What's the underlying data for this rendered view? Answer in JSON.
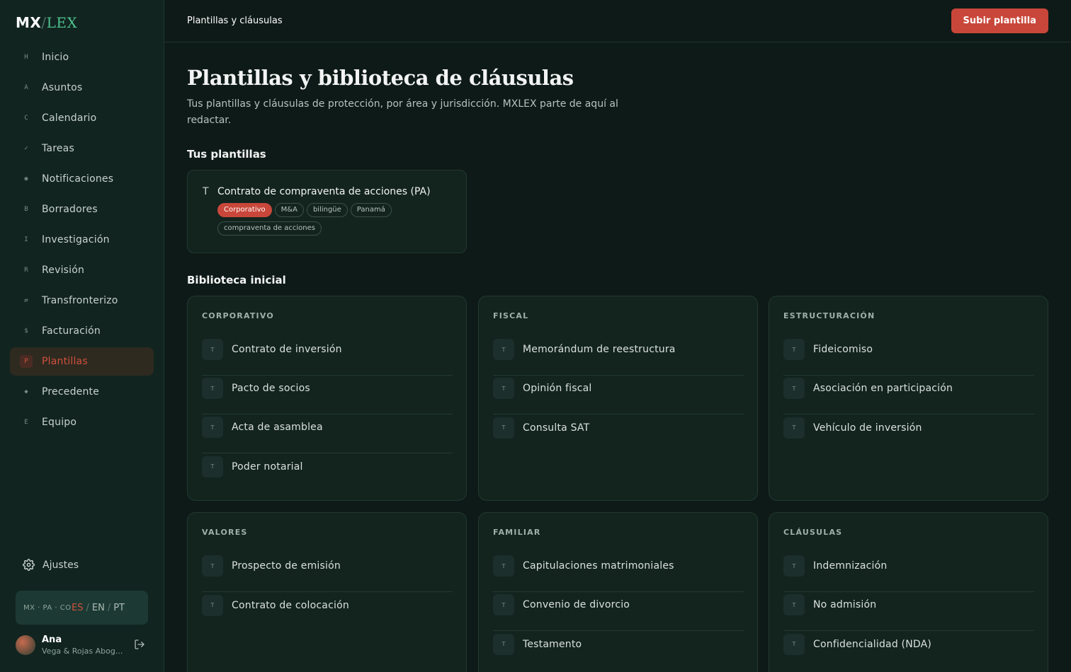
{
  "brand": {
    "mx": "MX",
    "slash": "/",
    "lex": "LEX"
  },
  "sidebar": {
    "items": [
      {
        "icon": "H",
        "label": "Inicio"
      },
      {
        "icon": "A",
        "label": "Asuntos"
      },
      {
        "icon": "C",
        "label": "Calendario"
      },
      {
        "icon": "✓",
        "label": "Tareas"
      },
      {
        "icon": "◉",
        "label": "Notificaciones"
      },
      {
        "icon": "B",
        "label": "Borradores"
      },
      {
        "icon": "I",
        "label": "Investigación"
      },
      {
        "icon": "R",
        "label": "Revisión"
      },
      {
        "icon": "⇄",
        "label": "Transfronterizo"
      },
      {
        "icon": "$",
        "label": "Facturación"
      },
      {
        "icon": "P",
        "label": "Plantillas",
        "active": true
      },
      {
        "icon": "◆",
        "label": "Precedente"
      },
      {
        "icon": "E",
        "label": "Equipo"
      }
    ],
    "settings_label": "Ajustes",
    "jurisdictions": "MX · PA · CO",
    "languages": {
      "es": "ES",
      "en": "EN",
      "pt": "PT",
      "sep": "/"
    },
    "user": {
      "name": "Ana",
      "firm": "Vega & Rojas Abog..."
    }
  },
  "topbar": {
    "breadcrumb": "Plantillas y cláusulas",
    "upload_label": "Subir plantilla"
  },
  "main": {
    "title": "Plantillas y biblioteca de cláusulas",
    "subtitle": "Tus plantillas y cláusulas de protección, por área y jurisdicción. MXLEX parte de aquí al redactar.",
    "your_templates_title": "Tus plantillas",
    "template": {
      "icon": "T",
      "name": "Contrato de compraventa de acciones (PA)",
      "tags": [
        "Corporativo",
        "M&A",
        "bilingüe",
        "Panamá",
        "compraventa de acciones"
      ]
    },
    "library_title": "Biblioteca inicial",
    "categories": [
      {
        "label": "CORPORATIVO",
        "items": [
          "Contrato de inversión",
          "Pacto de socios",
          "Acta de asamblea",
          "Poder notarial"
        ]
      },
      {
        "label": "FISCAL",
        "items": [
          "Memorándum de reestructura",
          "Opinión fiscal",
          "Consulta SAT"
        ]
      },
      {
        "label": "ESTRUCTURACIÓN",
        "items": [
          "Fideicomiso",
          "Asociación en participación",
          "Vehículo de inversión"
        ]
      },
      {
        "label": "VALORES",
        "items": [
          "Prospecto de emisión",
          "Contrato de colocación"
        ]
      },
      {
        "label": "FAMILIAR",
        "items": [
          "Capitulaciones matrimoniales",
          "Convenio de divorcio",
          "Testamento"
        ]
      },
      {
        "label": "CLÁUSULAS",
        "items": [
          "Indemnización",
          "No admisión",
          "Confidencialidad (NDA)"
        ]
      }
    ],
    "item_badge": "T"
  },
  "colors": {
    "accent": "#c9473a",
    "brand_green": "#4fc28f",
    "background": "#0e1a17"
  }
}
